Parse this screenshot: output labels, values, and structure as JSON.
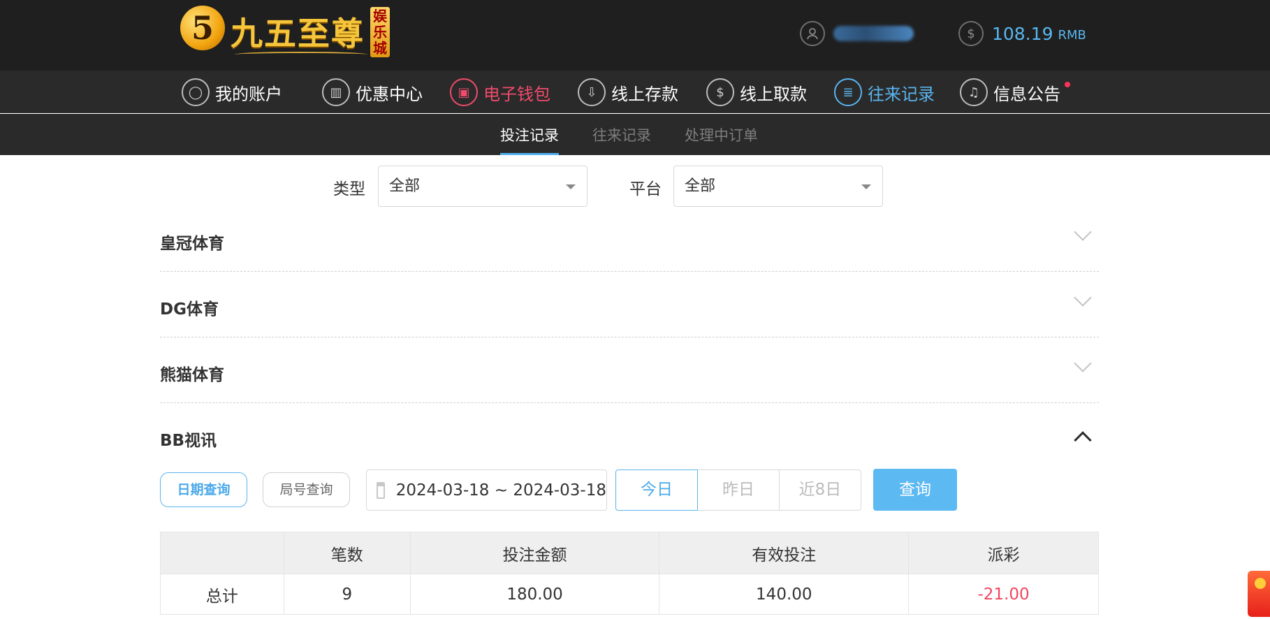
{
  "header": {
    "logo": {
      "mark": "5",
      "text": "九五至尊",
      "badge": "娱乐城"
    },
    "user": {
      "icon": "user-icon"
    },
    "balance": {
      "icon": "dollar-icon",
      "value": "108.19",
      "currency": "RMB"
    }
  },
  "nav": {
    "items": [
      {
        "label": "我的账户",
        "icon": "user-icon",
        "glyph": "◯"
      },
      {
        "label": "优惠中心",
        "icon": "gift-icon",
        "glyph": "▥"
      },
      {
        "label": "电子钱包",
        "icon": "wallet-icon",
        "glyph": "▣"
      },
      {
        "label": "线上存款",
        "icon": "deposit-icon",
        "glyph": "⇩"
      },
      {
        "label": "线上取款",
        "icon": "withdraw-icon",
        "glyph": "$"
      },
      {
        "label": "往来记录",
        "icon": "records-icon",
        "glyph": "≣"
      },
      {
        "label": "信息公告",
        "icon": "bell-icon",
        "glyph": "♫"
      }
    ],
    "active_color": "#5ab4ee",
    "wallet_color": "#f04b6b"
  },
  "subtabs": [
    "投注记录",
    "往来记录",
    "处理中订单"
  ],
  "filters": {
    "type_label": "类型",
    "type_value": "全部",
    "platform_label": "平台",
    "platform_value": "全部"
  },
  "sections": [
    "皇冠体育",
    "DG体育",
    "熊猫体育",
    "BB视讯"
  ],
  "query": {
    "date_mode": "日期查询",
    "round_mode": "局号查询",
    "date_range": "2024-03-18 ~ 2024-03-18",
    "quick": [
      "今日",
      "昨日",
      "近8日"
    ],
    "submit": "查询"
  },
  "summary_table": {
    "headers": [
      "",
      "笔数",
      "投注金额",
      "有效投注",
      "派彩"
    ],
    "row": [
      "总计",
      "9",
      "180.00",
      "140.00",
      "-21.00"
    ]
  }
}
